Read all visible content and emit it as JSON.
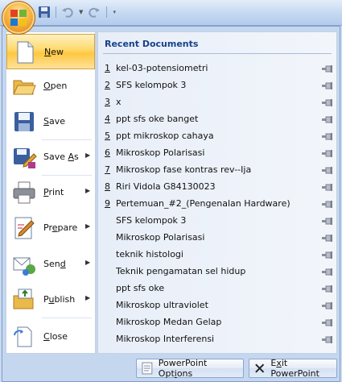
{
  "menu": {
    "items": [
      {
        "pre": "",
        "key": "N",
        "post": "ew",
        "icon": "new-document-icon",
        "submenu": false,
        "selected": true
      },
      {
        "pre": "",
        "key": "O",
        "post": "pen",
        "icon": "open-folder-icon",
        "submenu": false,
        "selected": false
      },
      {
        "pre": "",
        "key": "S",
        "post": "ave",
        "icon": "save-disk-icon",
        "submenu": false,
        "selected": false
      },
      {
        "pre": "Save ",
        "key": "A",
        "post": "s",
        "icon": "save-as-icon",
        "submenu": true,
        "selected": false
      },
      {
        "pre": "",
        "key": "P",
        "post": "rint",
        "icon": "printer-icon",
        "submenu": true,
        "selected": false
      },
      {
        "pre": "Pr",
        "key": "e",
        "post": "pare",
        "icon": "prepare-pen-icon",
        "submenu": true,
        "selected": false
      },
      {
        "pre": "Sen",
        "key": "d",
        "post": "",
        "icon": "send-icon",
        "submenu": true,
        "selected": false
      },
      {
        "pre": "P",
        "key": "u",
        "post": "blish",
        "icon": "publish-icon",
        "submenu": true,
        "selected": false
      },
      {
        "pre": "",
        "key": "C",
        "post": "lose",
        "icon": "close-folder-icon",
        "submenu": false,
        "selected": false
      }
    ]
  },
  "recent": {
    "title": "Recent Documents",
    "documents": [
      {
        "num": "1",
        "name": "kel-03-potensiometri"
      },
      {
        "num": "2",
        "name": "SFS kelompok 3"
      },
      {
        "num": "3",
        "name": "x"
      },
      {
        "num": "4",
        "name": "ppt sfs oke banget"
      },
      {
        "num": "5",
        "name": "ppt mikroskop cahaya"
      },
      {
        "num": "6",
        "name": "Mikroskop Polarisasi"
      },
      {
        "num": "7",
        "name": "Mikroskop fase kontras rev--Ija"
      },
      {
        "num": "8",
        "name": "Riri Vidola G84130023"
      },
      {
        "num": "9",
        "name": "Pertemuan_#2_(Pengenalan Hardware)"
      },
      {
        "num": "",
        "name": "SFS kelompok 3"
      },
      {
        "num": "",
        "name": "Mikroskop Polarisasi"
      },
      {
        "num": "",
        "name": "teknik histologi"
      },
      {
        "num": "",
        "name": "Teknik pengamatan sel hidup"
      },
      {
        "num": "",
        "name": "ppt sfs oke"
      },
      {
        "num": "",
        "name": "Mikroskop ultraviolet"
      },
      {
        "num": "",
        "name": "Mikroskop Medan Gelap"
      },
      {
        "num": "",
        "name": "Mikroskop Interferensi"
      }
    ]
  },
  "footer": {
    "options_pre": "PowerPoint Opt",
    "options_key": "i",
    "options_post": "ons",
    "exit_pre": "E",
    "exit_key": "x",
    "exit_post": "it PowerPoint"
  },
  "colors": {
    "selected_highlight": "#ffd86a",
    "heading_text": "#15428b",
    "panel_background": "#c5d7ef"
  }
}
